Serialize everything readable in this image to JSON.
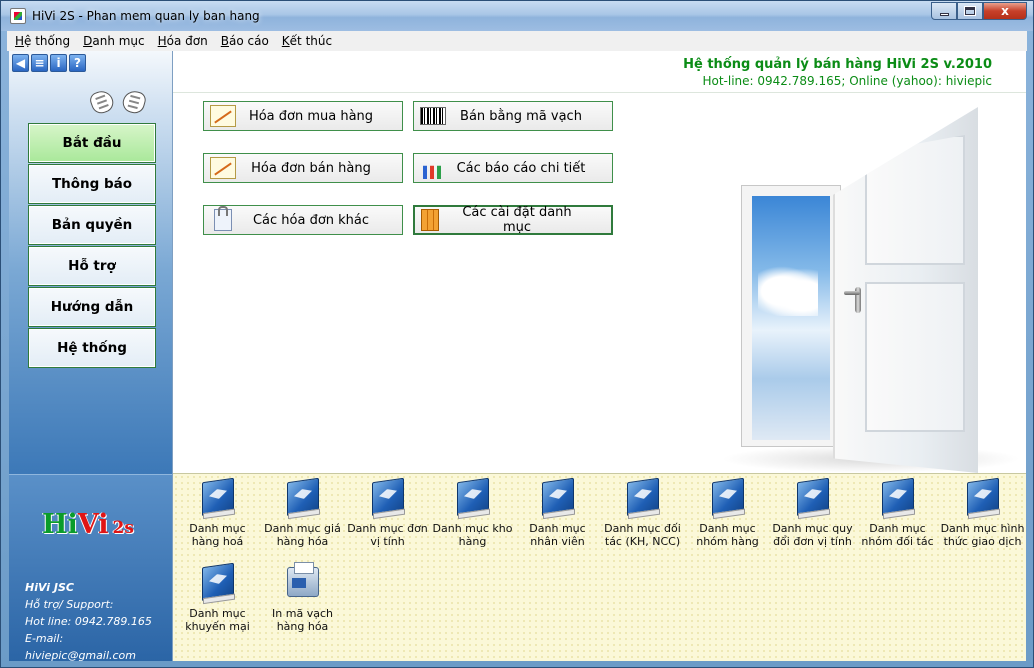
{
  "window": {
    "title": "HiVi 2S - Phan mem quan ly ban hang",
    "minimize_label": "",
    "maximize_label": "",
    "close_label": "x"
  },
  "menu": [
    {
      "label": "Hệ thống"
    },
    {
      "label": "Danh mục"
    },
    {
      "label": "Hóa đơn"
    },
    {
      "label": "Báo cáo"
    },
    {
      "label": "Kết thúc"
    }
  ],
  "toolbar": {
    "icons": [
      "back-icon",
      "document-icon",
      "info-icon",
      "help-icon"
    ],
    "info_glyph": "i",
    "help_glyph": "?"
  },
  "nav": [
    {
      "label": "Bắt đầu",
      "active": true
    },
    {
      "label": "Thông báo"
    },
    {
      "label": "Bản quyền"
    },
    {
      "label": "Hỗ trợ"
    },
    {
      "label": "Hướng dẫn"
    },
    {
      "label": "Hệ thống"
    }
  ],
  "brand": {
    "logo_hi": "Hi",
    "logo_vi": "Vi",
    "logo_suffix": "2s",
    "company": "HiVi JSC",
    "support": "Hỗ trợ/ Support:",
    "hotline": "Hot line: 0942.789.165",
    "email": "E-mail: hiviepic@gmail.com"
  },
  "header": {
    "title": "Hệ thống quản lý bán hàng HiVi 2S v.2010",
    "hotline": "Hot-line: 0942.789.165; Online (yahoo): hiviepic"
  },
  "actions": [
    {
      "label": "Hóa đơn mua hàng",
      "icon": "note-icon"
    },
    {
      "label": "Bán bằng mã vạch",
      "icon": "barcode-icon"
    },
    {
      "label": "Hóa đơn bán hàng",
      "icon": "note-icon"
    },
    {
      "label": "Các báo cáo chi tiết",
      "icon": "chart-icon"
    },
    {
      "label": "Các hóa đơn khác",
      "icon": "clipboard-icon"
    },
    {
      "label": "Các cài đặt danh mục",
      "icon": "cabinet-icon",
      "active": true
    }
  ],
  "categories": [
    {
      "label": "Danh mục hàng hoá"
    },
    {
      "label": "Danh mục giá hàng hóa"
    },
    {
      "label": "Danh mục đơn vị tính"
    },
    {
      "label": "Danh mục kho hàng"
    },
    {
      "label": "Danh mục nhân viên"
    },
    {
      "label": "Danh mục đối tác (KH, NCC)"
    },
    {
      "label": "Danh mục nhóm hàng"
    },
    {
      "label": "Danh mục quy đổi đơn vị tính"
    },
    {
      "label": "Danh mục nhóm đối tác"
    },
    {
      "label": "Danh mục hình thức giao dịch"
    },
    {
      "label": "Danh mục khuyến mại"
    },
    {
      "label": "In mã vạch hàng hóa",
      "icon": "printer-icon"
    }
  ],
  "colors": {
    "accent_green": "#0b8c16",
    "button_border": "#3f8f4a",
    "active_nav": "#a9e89a",
    "panel_blue": "#2a64a4",
    "logo_green": "#0a9c2a",
    "logo_red": "#e01515"
  }
}
